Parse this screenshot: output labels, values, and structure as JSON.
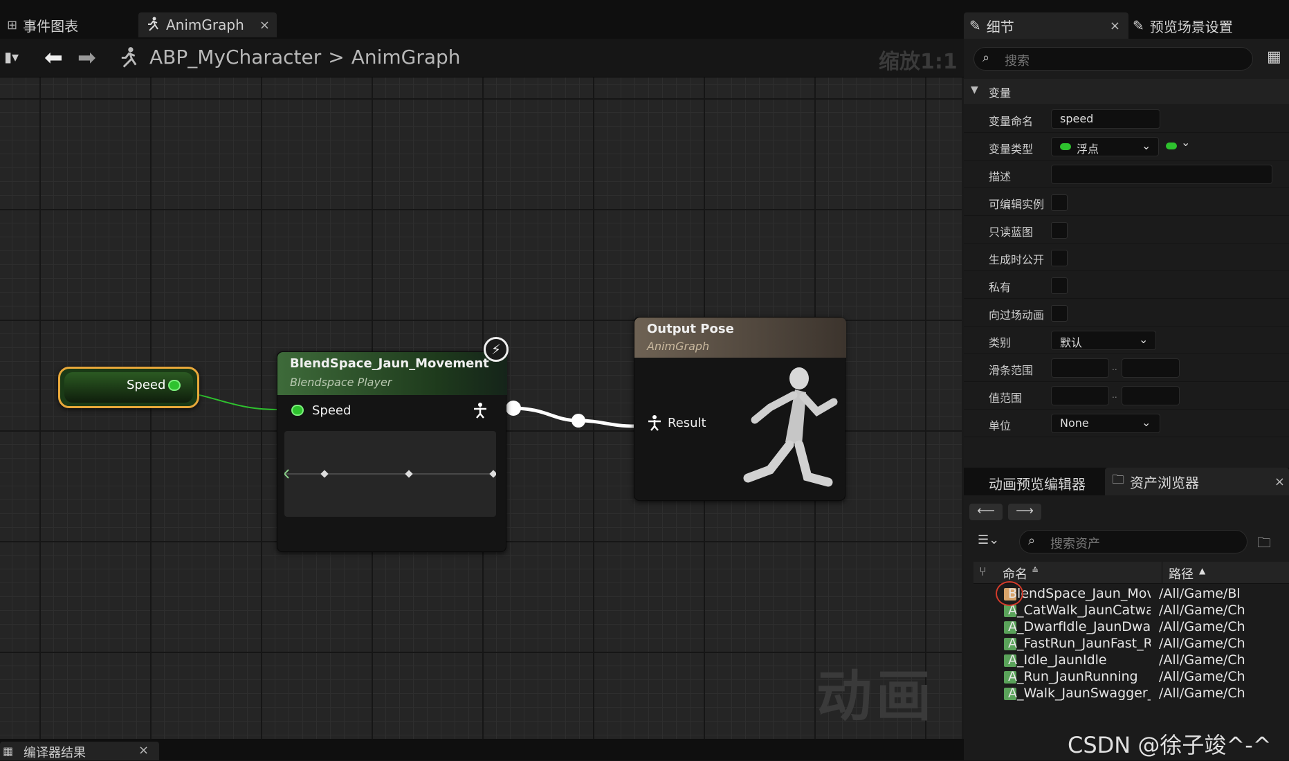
{
  "tabs": {
    "event_graph": "事件图表",
    "anim_graph": "AnimGraph",
    "close": "×"
  },
  "breadcrumb": {
    "root": "ABP_MyCharacter",
    "separator": ">",
    "current": "AnimGraph",
    "zoom": "缩放1:1"
  },
  "graph": {
    "watermark": "动画",
    "speed_var_node": {
      "label": "Speed"
    },
    "blendspace_node": {
      "title": "BlendSpace_Jaun_Movement",
      "subtitle": "Blendspace Player",
      "input_pin": "Speed"
    },
    "output_node": {
      "title": "Output Pose",
      "subtitle": "AnimGraph",
      "result_pin": "Result"
    }
  },
  "bottom_tab": {
    "label": "编译器结果",
    "close": "×"
  },
  "details": {
    "tab_details": "细节",
    "tab_preview": "预览场景设置",
    "search_placeholder": "搜索",
    "section": "变量",
    "rows": {
      "var_name_label": "变量命名",
      "var_name_value": "speed",
      "var_type_label": "变量类型",
      "var_type_value": "浮点",
      "desc_label": "描述",
      "editable_label": "可编辑实例",
      "readonly_label": "只读蓝图",
      "expose_label": "生成时公开",
      "private_label": "私有",
      "cinematic_label": "向过场动画公开",
      "category_label": "类别",
      "category_value": "默认",
      "slider_label": "滑条范围",
      "value_range_label": "值范围",
      "units_label": "单位",
      "units_value": "None",
      "range_sep": ".."
    }
  },
  "lower_panel": {
    "tab_anim_preview": "动画预览编辑器",
    "tab_asset_browser": "资产浏览器",
    "close": "×",
    "search_placeholder": "搜索资产",
    "col_name": "命名",
    "col_path": "路径",
    "assets": [
      {
        "name": "BlendSpace_Jaun_Movement",
        "path": "/All/Game/Bl"
      },
      {
        "name": "A_CatWalk_JaunCatwalk_W",
        "path": "/All/Game/Ch"
      },
      {
        "name": "A_DwarfIdle_JaunDwarf_Idl",
        "path": "/All/Game/Ch"
      },
      {
        "name": "A_FastRun_JaunFast_Run",
        "path": "/All/Game/Ch"
      },
      {
        "name": "A_Idle_JaunIdle",
        "path": "/All/Game/Ch"
      },
      {
        "name": "A_Run_JaunRunning",
        "path": "/All/Game/Ch"
      },
      {
        "name": "A_Walk_JaunSwagger_Walk",
        "path": "/All/Game/Ch"
      }
    ]
  },
  "credit": "CSDN @徐子竣^-^",
  "colors": {
    "float_pin": "#2ec22e",
    "selected_outline": "#e8a83a",
    "annotation_circle": "#d23a2a"
  }
}
